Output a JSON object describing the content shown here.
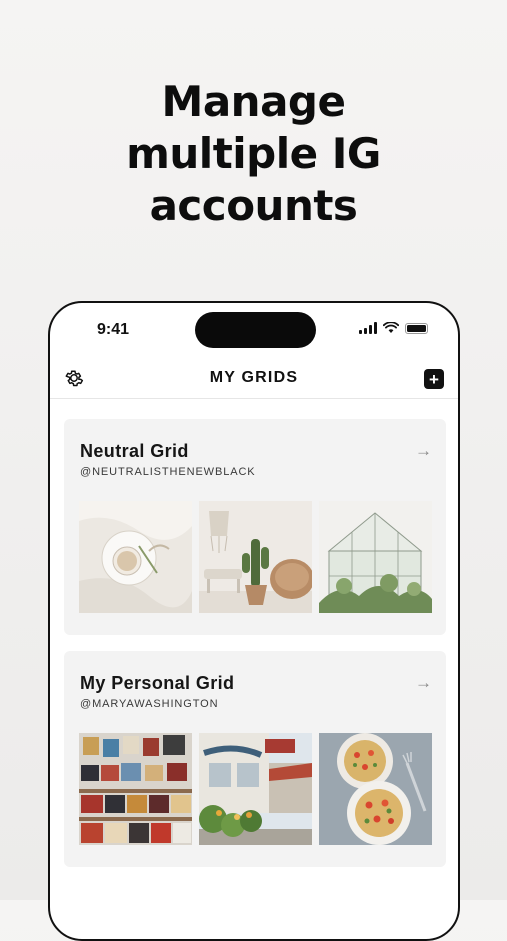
{
  "headline": {
    "lines": [
      "Manage",
      "multiple IG",
      "accounts"
    ]
  },
  "status_bar": {
    "time": "9:41",
    "icons": [
      "signal-icon",
      "wifi-icon",
      "battery-icon"
    ]
  },
  "nav": {
    "title": "MY GRIDS",
    "left_icon": "gear-icon",
    "right_icon": "plus-icon",
    "plus_glyph": "+"
  },
  "grids": [
    {
      "title": "Neutral Grid",
      "handle": "@NEUTRALISTHENEWBLACK",
      "arrow": "→",
      "thumbnails": [
        "white-bedding-with-plate-photo",
        "cactus-and-rattan-chair-photo",
        "glass-greenhouse-photo"
      ]
    },
    {
      "title": "My Personal Grid",
      "handle": "@MARYAWASHINGTON",
      "arrow": "→",
      "thumbnails": [
        "vinyl-record-wall-photo",
        "street-cafe-with-flowers-photo",
        "pasta-bowls-photo"
      ]
    }
  ],
  "colors": {
    "background": "#f1f0ef",
    "card_background": "#f3f3f3",
    "text": "#111111",
    "accent": "#111111"
  }
}
